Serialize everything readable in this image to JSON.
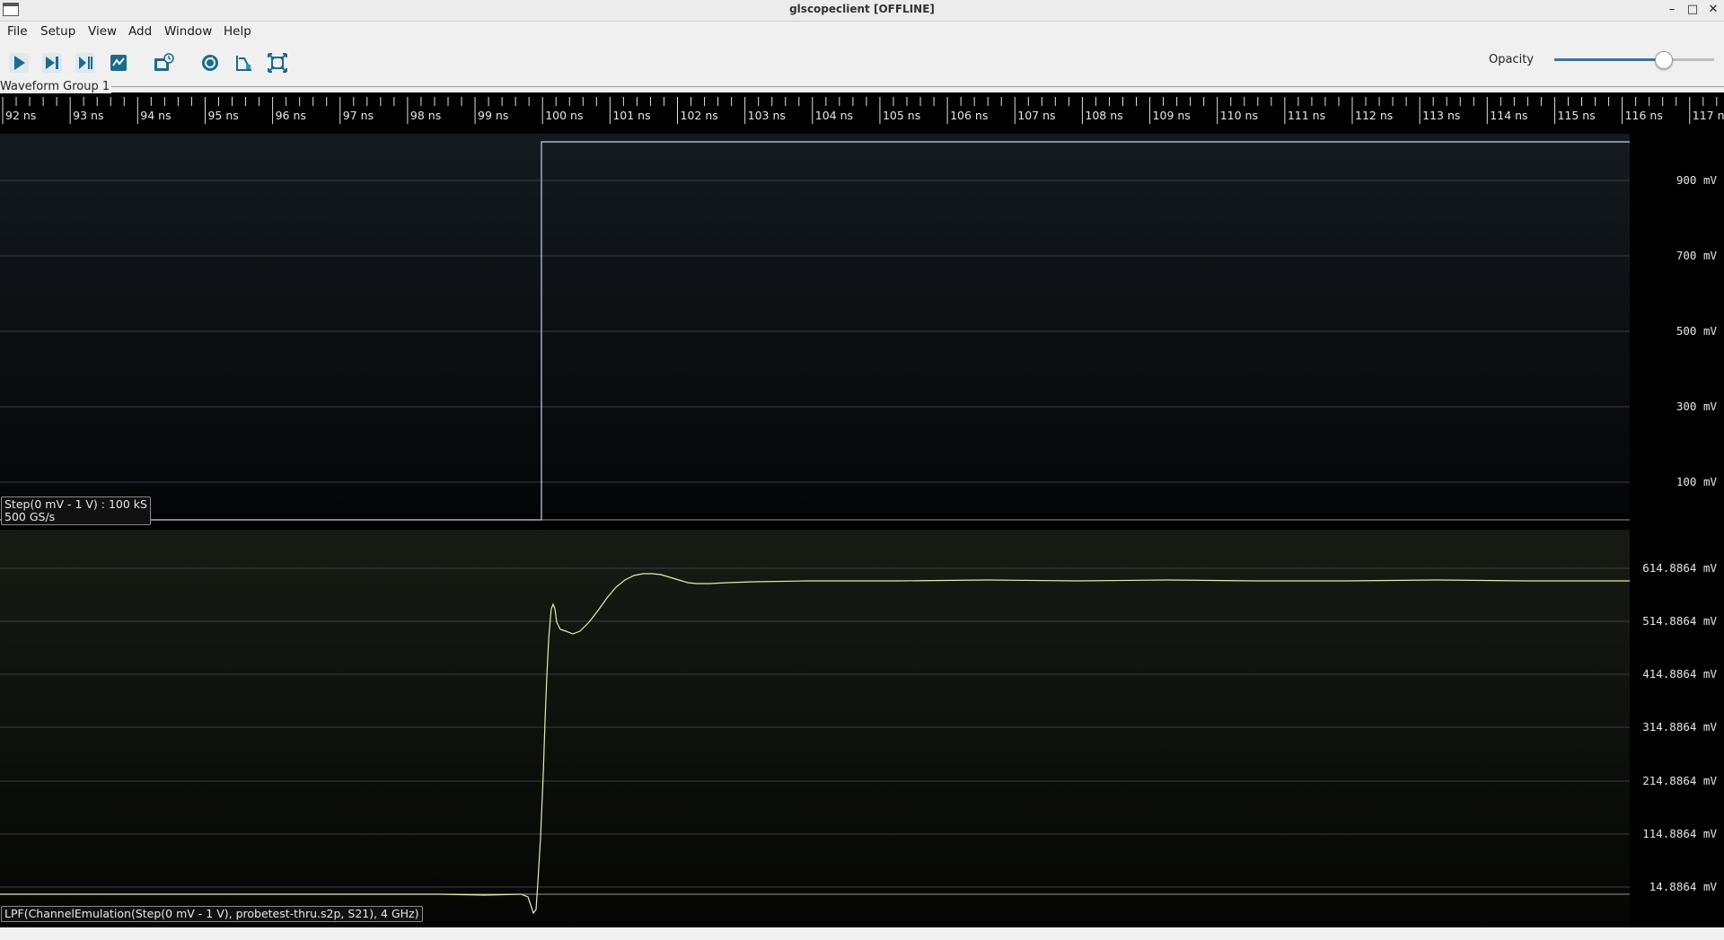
{
  "window": {
    "title": "glscopeclient [OFFLINE]",
    "controls": [
      "minimize-icon",
      "maximize-icon",
      "close-icon"
    ]
  },
  "menubar": {
    "items": [
      {
        "label": "File",
        "name": "menu-file"
      },
      {
        "label": "Setup",
        "name": "menu-setup"
      },
      {
        "label": "View",
        "name": "menu-view"
      },
      {
        "label": "Add",
        "name": "menu-add"
      },
      {
        "label": "Window",
        "name": "menu-window"
      },
      {
        "label": "Help",
        "name": "menu-help"
      }
    ]
  },
  "toolbar": {
    "buttons": [
      {
        "name": "start-trigger-button",
        "icon": "play-icon"
      },
      {
        "name": "single-trigger-button",
        "icon": "step-icon"
      },
      {
        "name": "force-trigger-button",
        "icon": "force-icon"
      },
      {
        "name": "stop-trigger-button",
        "icon": "stop-icon"
      },
      {
        "name": "history-button",
        "icon": "history-icon"
      },
      {
        "name": "refresh-settings-button",
        "icon": "refresh-icon"
      },
      {
        "name": "clear-sweeps-button",
        "icon": "clear-sweeps-icon"
      },
      {
        "name": "fullscreen-button",
        "icon": "fullscreen-icon"
      }
    ],
    "opacity_label": "Opacity",
    "opacity_value": 0.68
  },
  "waveform_group": {
    "title": "Waveform Group 1",
    "timeline_ticks": [
      "92 ns",
      "93 ns",
      "94 ns",
      "95 ns",
      "96 ns",
      "97 ns",
      "98 ns",
      "99 ns",
      "100 ns",
      "101 ns",
      "102 ns",
      "103 ns",
      "104 ns",
      "105 ns",
      "106 ns",
      "107 ns",
      "108 ns",
      "109 ns",
      "110 ns",
      "111 ns",
      "112 ns",
      "113 ns",
      "114 ns",
      "115 ns",
      "116 ns",
      "117 ns"
    ]
  },
  "channels": [
    {
      "name": "step-channel",
      "label_line1": "Step(0 mV - 1 V) : 100 kS",
      "label_line2": "500 GS/s",
      "axis_labels": [
        "900 mV",
        "700 mV",
        "500 mV",
        "300 mV",
        "100 mV"
      ],
      "trace_color": "#c8d2e6"
    },
    {
      "name": "lpf-channel",
      "label_line1": "LPF(ChannelEmulation(Step(0 mV - 1 V), probetest-thru.s2p, S21), 4 GHz)",
      "axis_labels": [
        "614.8864 mV",
        "514.8864 mV",
        "414.8864 mV",
        "314.8864 mV",
        "214.8864 mV",
        "114.8864 mV",
        "14.8864 mV"
      ],
      "trace_color": "#e4eea8"
    }
  ],
  "colors": {
    "accent": "#1c7ad0",
    "plot_background": "#000000",
    "grid": "#3a3f44"
  }
}
